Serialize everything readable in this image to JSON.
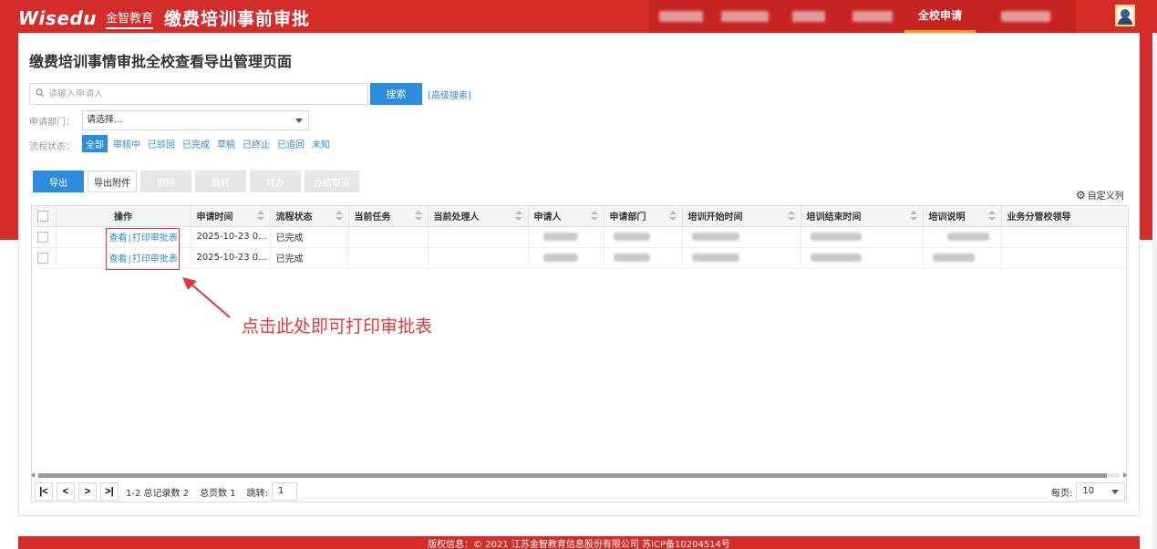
{
  "header": {
    "logo_text": "Wisedu",
    "logo_cn": "金智教育",
    "app_title": "缴费培训事前审批",
    "nav": [
      {
        "label": "",
        "blurred": true
      },
      {
        "label": "",
        "blurred": true
      },
      {
        "label": "",
        "blurred": true
      },
      {
        "label": "",
        "blurred": true
      },
      {
        "label": "全校申请",
        "active": true
      },
      {
        "label": "",
        "blurred": true
      }
    ]
  },
  "page": {
    "title": "缴费培训事情审批全校查看导出管理页面"
  },
  "search": {
    "placeholder": "请输入申请人",
    "button_label": "搜索",
    "advanced_label": "[高级搜索]"
  },
  "filters": {
    "dept_label": "申请部门：",
    "dept_value": "请选择...",
    "status_label": "流程状态：",
    "status_options": [
      "全部",
      "审核中",
      "已驳回",
      "已完成",
      "草稿",
      "已终止",
      "已追回",
      "未知"
    ],
    "status_active": "全部"
  },
  "toolbar": {
    "export": "导出",
    "export_attach": "导出附件",
    "delete": "删除",
    "jump": "跳转",
    "transfer": "转办",
    "cancel_done": "办结取消",
    "custom_cols": "自定义列"
  },
  "table": {
    "columns": [
      "操作",
      "申请时间",
      "流程状态",
      "当前任务",
      "当前处理人",
      "申请人",
      "申请部门",
      "培训开始时间",
      "培训结束时间",
      "培训说明",
      "业务分管校领导"
    ],
    "rows": [
      {
        "view": "查看",
        "print": "打印审批表",
        "time": "2025-10-23 0...",
        "status": "已完成"
      },
      {
        "view": "查看",
        "print": "打印审批表",
        "time": "2025-10-23 0...",
        "status": "已完成"
      }
    ]
  },
  "pager": {
    "first": "|<",
    "prev": "<",
    "next": ">",
    "last": ">|",
    "range": "1-2 总记录数 2",
    "pages": "总页数 1",
    "jump_label": "跳转:",
    "jump_value": "1",
    "per_page_label": "每页:",
    "per_page_value": "10"
  },
  "annotation": {
    "text": "点击此处即可打印审批表"
  },
  "footer": {
    "text": "版权信息：© 2021 江苏金智教育信息股份有限公司 苏ICP备10204514号"
  },
  "colors": {
    "brand_red": "#d42b2b",
    "accent_blue": "#2b8ce0",
    "annotation_red": "#e53935",
    "active_underline": "#f59b1a"
  }
}
